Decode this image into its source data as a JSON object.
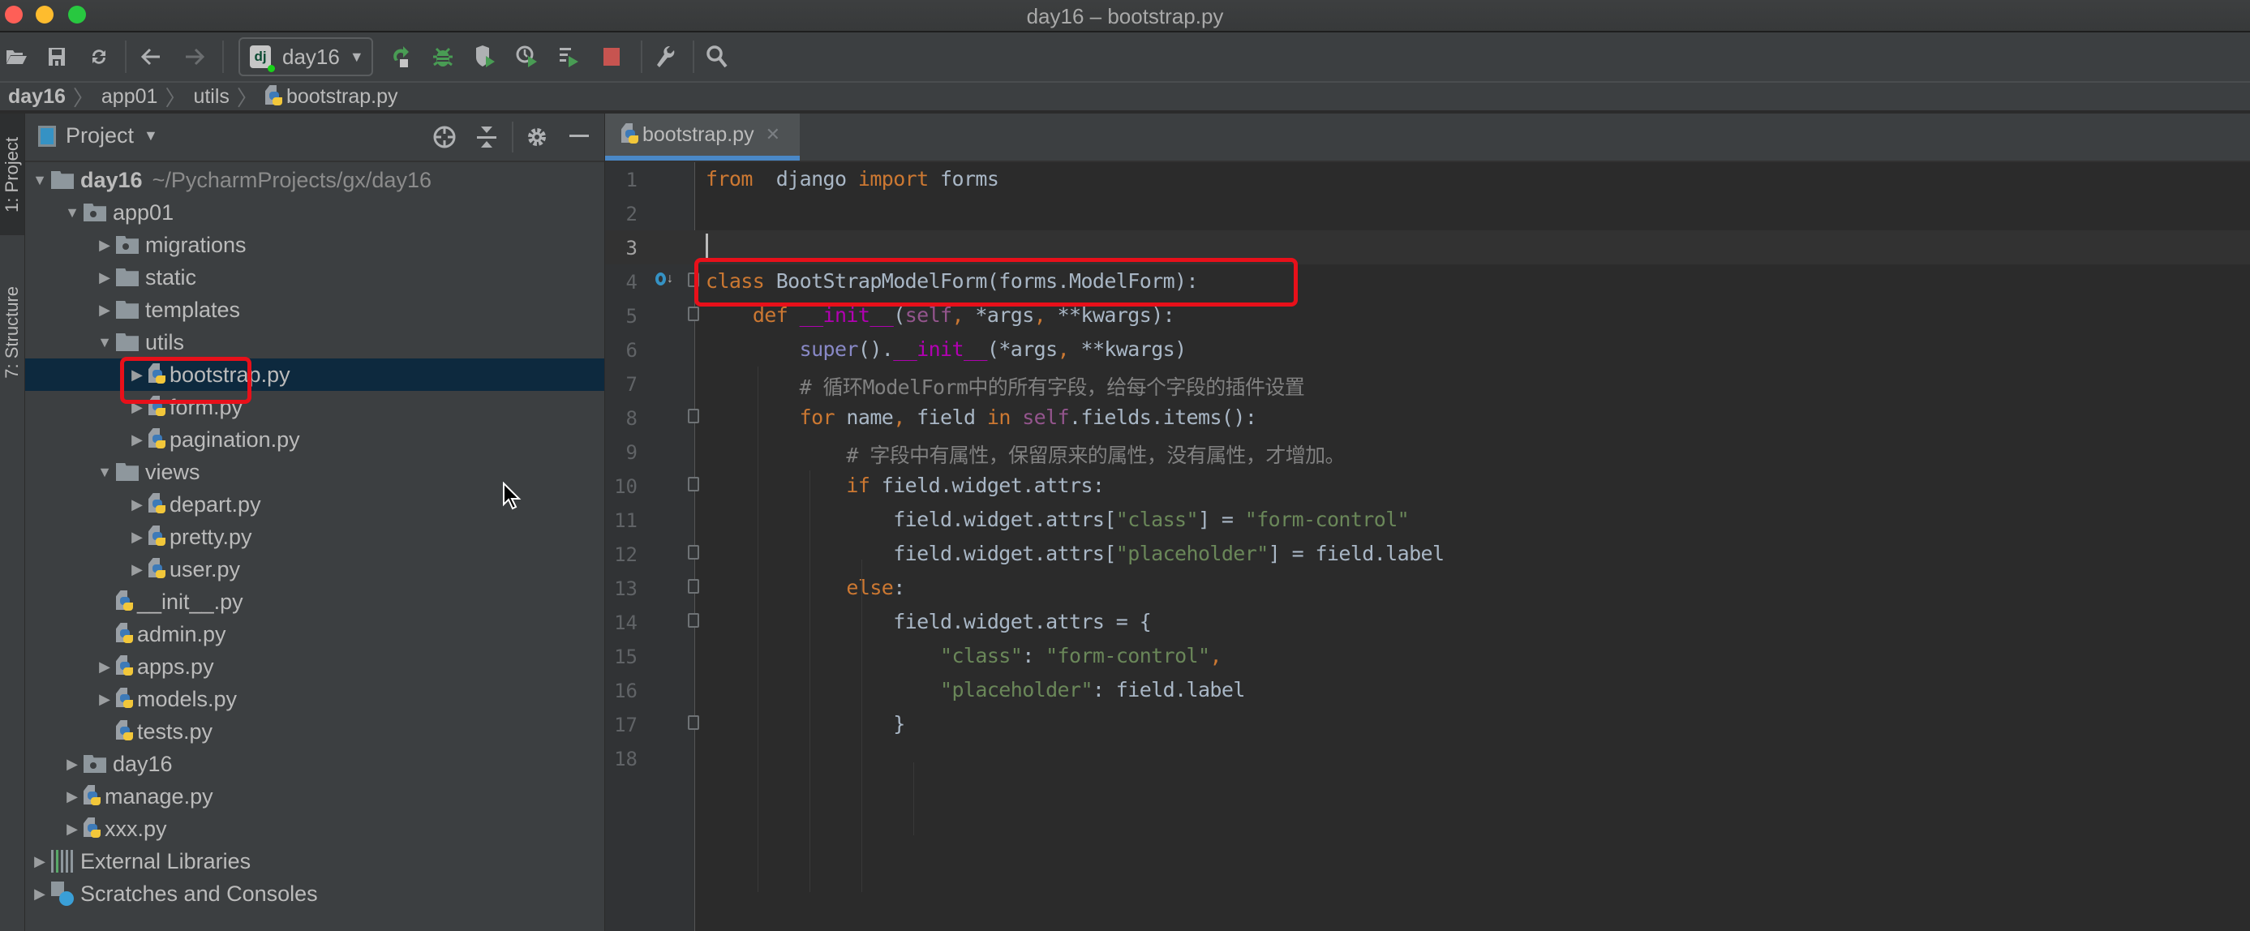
{
  "window": {
    "title": "day16 – bootstrap.py"
  },
  "toolbar": {
    "icons": [
      "open-folder-icon",
      "save-icon",
      "sync-icon",
      "back-icon",
      "forward-icon",
      "rerun-icon",
      "debug-icon",
      "coverage-icon",
      "profile-icon",
      "concurrency-icon",
      "stop-icon",
      "wrench-icon",
      "search-icon"
    ],
    "run_config": {
      "label": "day16",
      "icon": "dj"
    }
  },
  "breadcrumb": {
    "items": [
      "day16",
      "app01",
      "utils",
      "bootstrap.py"
    ]
  },
  "left_strip": {
    "tabs": [
      "1: Project",
      "7: Structure"
    ]
  },
  "project_panel": {
    "title": "Project",
    "tree": [
      {
        "label": "day16",
        "detail": "~/PycharmProjects/gx/day16",
        "type": "folder",
        "depth": 0,
        "expanded": true
      },
      {
        "label": "app01",
        "type": "module",
        "depth": 1,
        "expanded": true
      },
      {
        "label": "migrations",
        "type": "module",
        "depth": 2,
        "expanded": false
      },
      {
        "label": "static",
        "type": "folder",
        "depth": 2,
        "expanded": false
      },
      {
        "label": "templates",
        "type": "folder",
        "depth": 2,
        "expanded": false
      },
      {
        "label": "utils",
        "type": "folder",
        "depth": 2,
        "expanded": true
      },
      {
        "label": "bootstrap.py",
        "type": "python",
        "depth": 3,
        "expanded": false,
        "selected": true
      },
      {
        "label": "form.py",
        "type": "python",
        "depth": 3,
        "expanded": false
      },
      {
        "label": "pagination.py",
        "type": "python",
        "depth": 3,
        "expanded": false
      },
      {
        "label": "views",
        "type": "folder",
        "depth": 2,
        "expanded": true
      },
      {
        "label": "depart.py",
        "type": "python",
        "depth": 3,
        "expanded": false
      },
      {
        "label": "pretty.py",
        "type": "python",
        "depth": 3,
        "expanded": false
      },
      {
        "label": "user.py",
        "type": "python",
        "depth": 3,
        "expanded": false
      },
      {
        "label": "__init__.py",
        "type": "python",
        "depth": 2,
        "leaf": true
      },
      {
        "label": "admin.py",
        "type": "python",
        "depth": 2,
        "leaf": true
      },
      {
        "label": "apps.py",
        "type": "python",
        "depth": 2,
        "expanded": false
      },
      {
        "label": "models.py",
        "type": "python",
        "depth": 2,
        "expanded": false
      },
      {
        "label": "tests.py",
        "type": "python",
        "depth": 2,
        "leaf": true
      },
      {
        "label": "day16",
        "type": "module",
        "depth": 1,
        "expanded": false
      },
      {
        "label": "manage.py",
        "type": "python",
        "depth": 1,
        "expanded": false
      },
      {
        "label": "xxx.py",
        "type": "python",
        "depth": 1,
        "expanded": false
      },
      {
        "label": "External Libraries",
        "type": "libs",
        "depth": 0,
        "expanded": false
      },
      {
        "label": "Scratches and Consoles",
        "type": "scratch",
        "depth": 0,
        "expanded": false
      }
    ]
  },
  "editor": {
    "tab": {
      "label": "bootstrap.py"
    },
    "current_line": 3,
    "lines": [
      {
        "n": "1",
        "tokens": [
          [
            "kw",
            "from"
          ],
          [
            "",
            "  django "
          ],
          [
            "kw",
            "import"
          ],
          [
            "",
            " forms"
          ]
        ]
      },
      {
        "n": "2",
        "tokens": []
      },
      {
        "n": "3",
        "tokens": []
      },
      {
        "n": "4",
        "tokens": [
          [
            "kw",
            "class"
          ],
          [
            "",
            " BootStrapModelForm(forms.ModelForm):"
          ]
        ]
      },
      {
        "n": "5",
        "tokens": [
          [
            "",
            "    "
          ],
          [
            "kw",
            "def"
          ],
          [
            "",
            " "
          ],
          [
            "magic",
            "__init__"
          ],
          [
            "",
            "("
          ],
          [
            "self",
            "self"
          ],
          [
            "kw",
            ","
          ],
          [
            "",
            " *args"
          ],
          [
            "kw",
            ","
          ],
          [
            "",
            " **kwargs):"
          ]
        ]
      },
      {
        "n": "6",
        "tokens": [
          [
            "",
            "        "
          ],
          [
            "bi",
            "super"
          ],
          [
            "",
            "()."
          ],
          [
            "magic",
            "__init__"
          ],
          [
            "",
            "(*args"
          ],
          [
            "kw",
            ","
          ],
          [
            "",
            " **kwargs)"
          ]
        ]
      },
      {
        "n": "7",
        "tokens": [
          [
            "",
            "        "
          ],
          [
            "cm",
            "# 循环ModelForm中的所有字段，给每个字段的插件设置"
          ]
        ]
      },
      {
        "n": "8",
        "tokens": [
          [
            "",
            "        "
          ],
          [
            "kw",
            "for"
          ],
          [
            "",
            " name"
          ],
          [
            "kw",
            ","
          ],
          [
            "",
            " field "
          ],
          [
            "kw",
            "in"
          ],
          [
            "",
            " "
          ],
          [
            "self",
            "self"
          ],
          [
            "",
            ".fields.items():"
          ]
        ]
      },
      {
        "n": "9",
        "tokens": [
          [
            "",
            "            "
          ],
          [
            "cm",
            "# 字段中有属性，保留原来的属性，没有属性，才增加。"
          ]
        ]
      },
      {
        "n": "10",
        "tokens": [
          [
            "",
            "            "
          ],
          [
            "kw",
            "if"
          ],
          [
            "",
            " field.widget.attrs:"
          ]
        ]
      },
      {
        "n": "11",
        "tokens": [
          [
            "",
            "                field.widget.attrs["
          ],
          [
            "str",
            "\"class\""
          ],
          [
            "",
            "] = "
          ],
          [
            "str",
            "\"form-control\""
          ]
        ]
      },
      {
        "n": "12",
        "tokens": [
          [
            "",
            "                field.widget.attrs["
          ],
          [
            "str",
            "\"placeholder\""
          ],
          [
            "",
            "] = field.label"
          ]
        ]
      },
      {
        "n": "13",
        "tokens": [
          [
            "",
            "            "
          ],
          [
            "kw",
            "else"
          ],
          [
            "",
            ":"
          ]
        ]
      },
      {
        "n": "14",
        "tokens": [
          [
            "",
            "                field.widget.attrs = {"
          ]
        ]
      },
      {
        "n": "15",
        "tokens": [
          [
            "",
            "                    "
          ],
          [
            "str",
            "\"class\""
          ],
          [
            "",
            ": "
          ],
          [
            "str",
            "\"form-control\""
          ],
          [
            "kw",
            ","
          ]
        ]
      },
      {
        "n": "16",
        "tokens": [
          [
            "",
            "                    "
          ],
          [
            "str",
            "\"placeholder\""
          ],
          [
            "",
            ": field.label"
          ]
        ]
      },
      {
        "n": "17",
        "tokens": [
          [
            "",
            "                }"
          ]
        ]
      },
      {
        "n": "18",
        "tokens": []
      }
    ],
    "fold_markers": [
      "4",
      "5",
      "8",
      "10",
      "12",
      "13",
      "14",
      "17"
    ]
  },
  "annotations": {
    "highlight_color": "#e8101a",
    "boxes": [
      "tree-item-bootstrap",
      "class-definition-line"
    ]
  }
}
